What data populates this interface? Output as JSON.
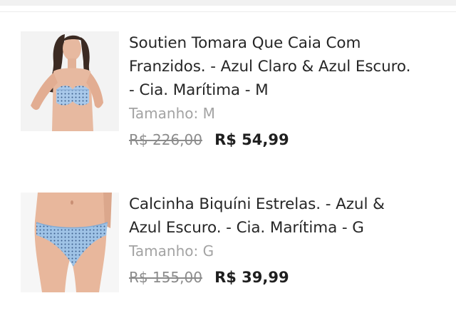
{
  "cart": {
    "items": [
      {
        "title_lines": [
          "Soutien Tomara Que Caia Com",
          "Franzidos. - Azul Claro & Azul Escuro.",
          "- Cia. Marítima - M"
        ],
        "size_label": "Tamanho: M",
        "old_price": "R$ 226,00",
        "new_price": "R$ 54,99",
        "image": "bikini-top-photo"
      },
      {
        "title_lines": [
          "Calcinha Biquíni Estrelas. - Azul &",
          "Azul Escuro. - Cia. Marítima - G"
        ],
        "size_label": "Tamanho: G",
        "old_price": "R$ 155,00",
        "new_price": "R$ 39,99",
        "image": "bikini-bottom-photo"
      }
    ]
  },
  "colors": {
    "background": "#ffffff",
    "title": "#262626",
    "muted": "#a3a3a3",
    "price": "#1f1f1f",
    "fabric": "#9fc3e6"
  }
}
